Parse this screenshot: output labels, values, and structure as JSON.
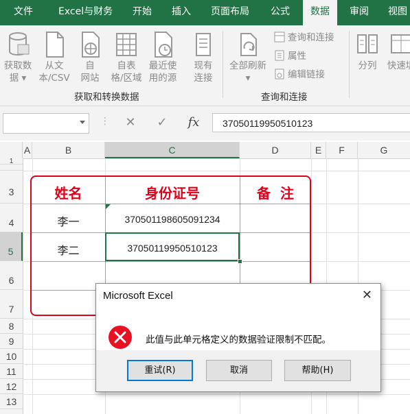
{
  "tabs": [
    "文件",
    "Excel与财务",
    "开始",
    "插入",
    "页面布局",
    "公式",
    "数据",
    "审阅",
    "视图"
  ],
  "active_tab": "数据",
  "ribbon": {
    "get_data": [
      "获取数",
      "据 ▾"
    ],
    "from_text": [
      "从文",
      "本/CSV"
    ],
    "from_web": [
      "自",
      "网站"
    ],
    "from_table": [
      "自表",
      "格/区域"
    ],
    "recent_sources": [
      "最近使",
      "用的源"
    ],
    "existing_connections": [
      "现有",
      "连接"
    ],
    "group1_label": "获取和转换数据",
    "refresh_all": [
      "全部刷新",
      "▾"
    ],
    "queries_connections": "查询和连接",
    "properties": "属性",
    "edit_links": "编辑链接",
    "group2_label": "查询和连接",
    "split": "分列",
    "flash_fill": "快速填"
  },
  "formula_bar": {
    "name_box": "",
    "cancel": "✕",
    "enter": "✓",
    "fx": "fx",
    "value": "370501199505 10123"
  },
  "columns": [
    "A",
    "B",
    "C",
    "D",
    "E",
    "F",
    "G"
  ],
  "selected_column": "C",
  "rows": [
    "1",
    "3",
    "4",
    "5",
    "6",
    "7",
    "8",
    "9",
    "10",
    "11",
    "12",
    "13"
  ],
  "selected_row": "5",
  "table": {
    "headers": [
      "姓名",
      "身份证号",
      "备  注"
    ],
    "rows": [
      {
        "name": "李一",
        "id": "370501198605091234",
        "note": ""
      },
      {
        "name": "李二",
        "id": "37050119950510123",
        "note": ""
      },
      {
        "name": "",
        "id": "",
        "note": ""
      },
      {
        "name": "",
        "id": "",
        "note": ""
      }
    ]
  },
  "dialog": {
    "title": "Microsoft Excel",
    "close": "✕",
    "message": "此值与此单元格定义的数据验证限制不匹配。",
    "icon": "error-icon",
    "buttons": {
      "retry": "重试(R)",
      "cancel": "取消",
      "help": "帮助(H)"
    }
  },
  "colors": {
    "excel_green": "#217346",
    "table_border": "#e0001a",
    "header_text": "#e0001a",
    "error_red": "#e81123",
    "focus_blue": "#0078d7"
  }
}
